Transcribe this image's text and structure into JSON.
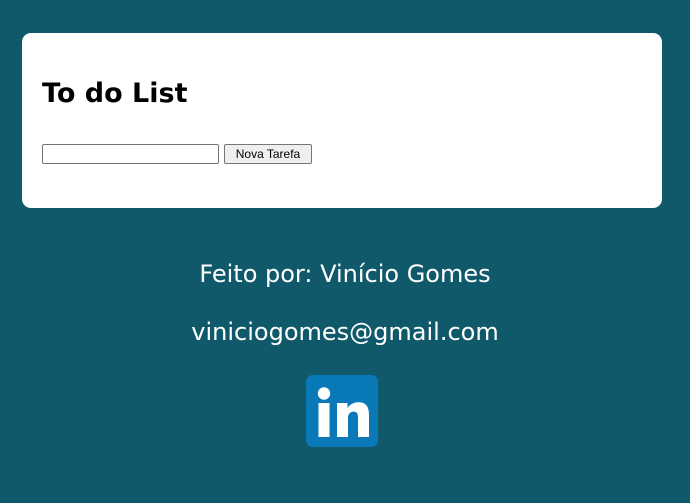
{
  "card": {
    "title": "To do List",
    "input_value": "",
    "input_placeholder": "",
    "add_button_label": "Nova Tarefa"
  },
  "footer": {
    "author": "Feito por: Vinício Gomes",
    "email": "viniciogomes@gmail.com",
    "social_icon": "linkedin-icon"
  },
  "colors": {
    "background": "#10596a",
    "card": "#ffffff",
    "linkedin": "#0a79b8"
  }
}
